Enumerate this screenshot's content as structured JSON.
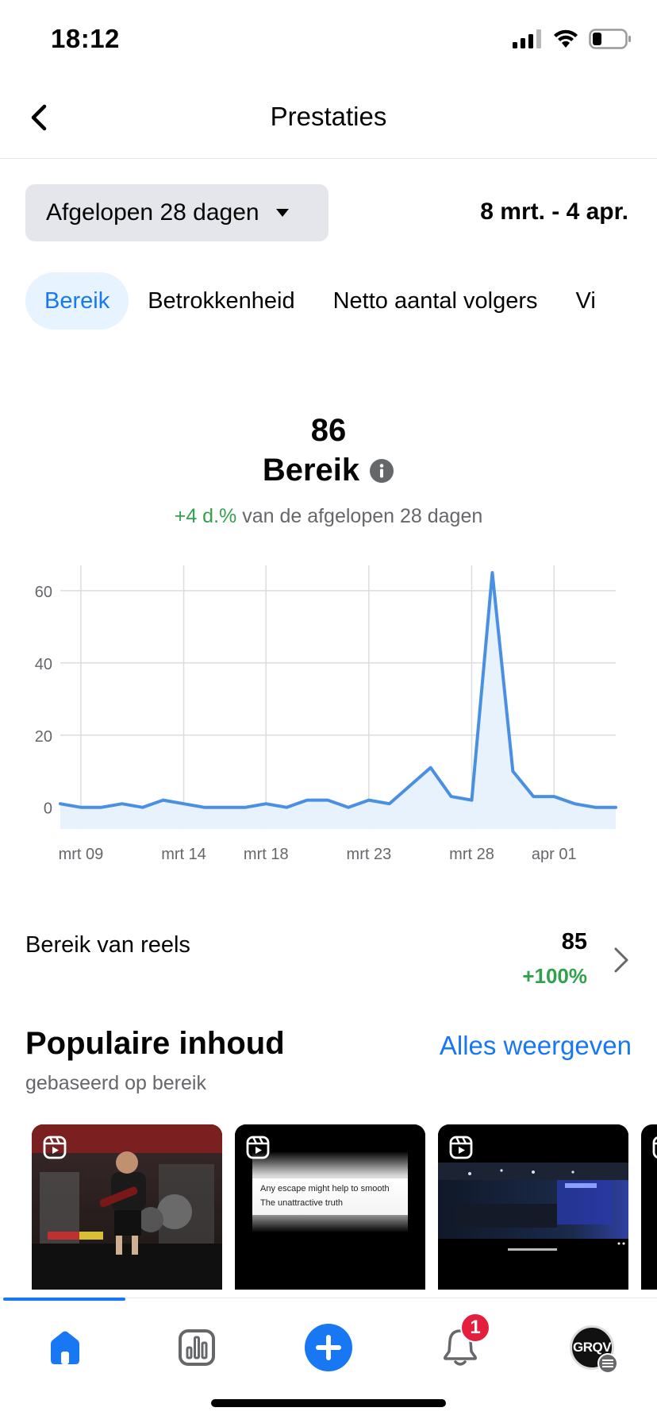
{
  "status_bar": {
    "time": "18:12"
  },
  "header": {
    "title": "Prestaties"
  },
  "filters": {
    "period": "Afgelopen 28 dagen",
    "date_range": "8 mrt. - 4 apr."
  },
  "tabs": [
    {
      "label": "Bereik",
      "active": true
    },
    {
      "label": "Betrokkenheid",
      "active": false
    },
    {
      "label": "Netto aantal volgers",
      "active": false
    },
    {
      "label": "Vi",
      "active": false
    }
  ],
  "metric": {
    "value": "86",
    "title": "Bereik",
    "change": "+4 d.%",
    "change_text": "van de afgelopen 28 dagen"
  },
  "chart_data": {
    "type": "area",
    "title": "",
    "xlabel": "",
    "ylabel": "",
    "x": [
      "mrt 08",
      "mrt 09",
      "mrt 10",
      "mrt 11",
      "mrt 12",
      "mrt 13",
      "mrt 14",
      "mrt 15",
      "mrt 16",
      "mrt 17",
      "mrt 18",
      "mrt 19",
      "mrt 20",
      "mrt 21",
      "mrt 22",
      "mrt 23",
      "mrt 24",
      "mrt 25",
      "mrt 26",
      "mrt 27",
      "mrt 28",
      "mrt 29",
      "mrt 30",
      "mrt 31",
      "apr 01",
      "apr 02",
      "apr 03",
      "apr 04"
    ],
    "series": [
      {
        "values": [
          1,
          0,
          0,
          1,
          0,
          2,
          1,
          0,
          0,
          0,
          1,
          0,
          2,
          2,
          0,
          2,
          1,
          6,
          11,
          3,
          2,
          65,
          10,
          3,
          3,
          1,
          0,
          0
        ],
        "color": "#4a90e2"
      }
    ],
    "x_ticks": [
      "mrt 09",
      "mrt 14",
      "mrt 18",
      "mrt 23",
      "mrt 28",
      "apr 01"
    ],
    "y_ticks": [
      0,
      20,
      40,
      60
    ],
    "ylim": [
      -6,
      67
    ],
    "grid": true
  },
  "reels": {
    "label": "Bereik van reels",
    "value": "85",
    "change": "+100%"
  },
  "popular": {
    "title": "Populaire inhoud",
    "see_all": "Alles weergeven",
    "subtitle": "gebaseerd op bereik",
    "items": [
      {
        "kind": "concert-photo"
      },
      {
        "kind": "text-reel",
        "lines": [
          "Any escape might help to smooth",
          "The unattractive truth"
        ]
      },
      {
        "kind": "stadium-video"
      }
    ]
  },
  "bottom_nav": {
    "items": [
      "home",
      "insights",
      "create",
      "notifications",
      "profile"
    ],
    "notification_count": "1",
    "avatar_text": "GRQV"
  },
  "colors": {
    "accent": "#1877f2",
    "positive": "#31a24c",
    "badge": "#e41e3f",
    "chart_line": "#4a90e2",
    "chart_fill": "#e7f1fd"
  }
}
